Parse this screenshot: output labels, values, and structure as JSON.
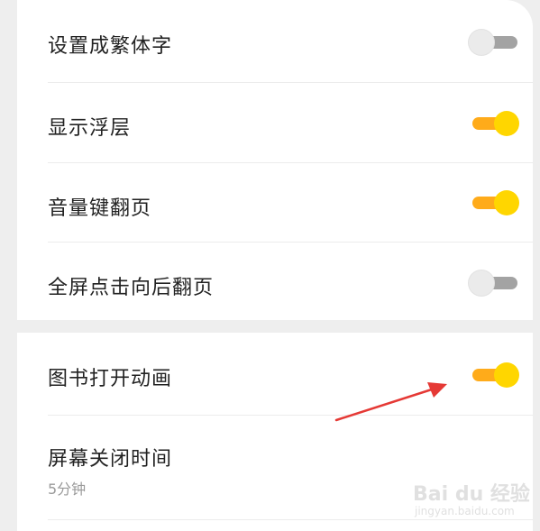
{
  "settings": {
    "group1": [
      {
        "label": "设置成繁体字",
        "state": "off"
      },
      {
        "label": "显示浮层",
        "state": "on"
      },
      {
        "label": "音量键翻页",
        "state": "on"
      },
      {
        "label": "全屏点击向后翻页",
        "state": "off"
      }
    ],
    "group2": [
      {
        "label": "图书打开动画",
        "state": "on"
      },
      {
        "label": "屏幕关闭时间",
        "value": "5分钟"
      }
    ]
  },
  "colors": {
    "toggle_on_track": "#ffab1a",
    "toggle_on_knob": "#ffd600",
    "toggle_off_track": "#a3a3a3",
    "toggle_off_knob": "#ebebeb",
    "annotation_arrow": "#e53935"
  },
  "watermark": {
    "logo_text": "Bai du 经验",
    "url": "jingyan.baidu.com"
  }
}
